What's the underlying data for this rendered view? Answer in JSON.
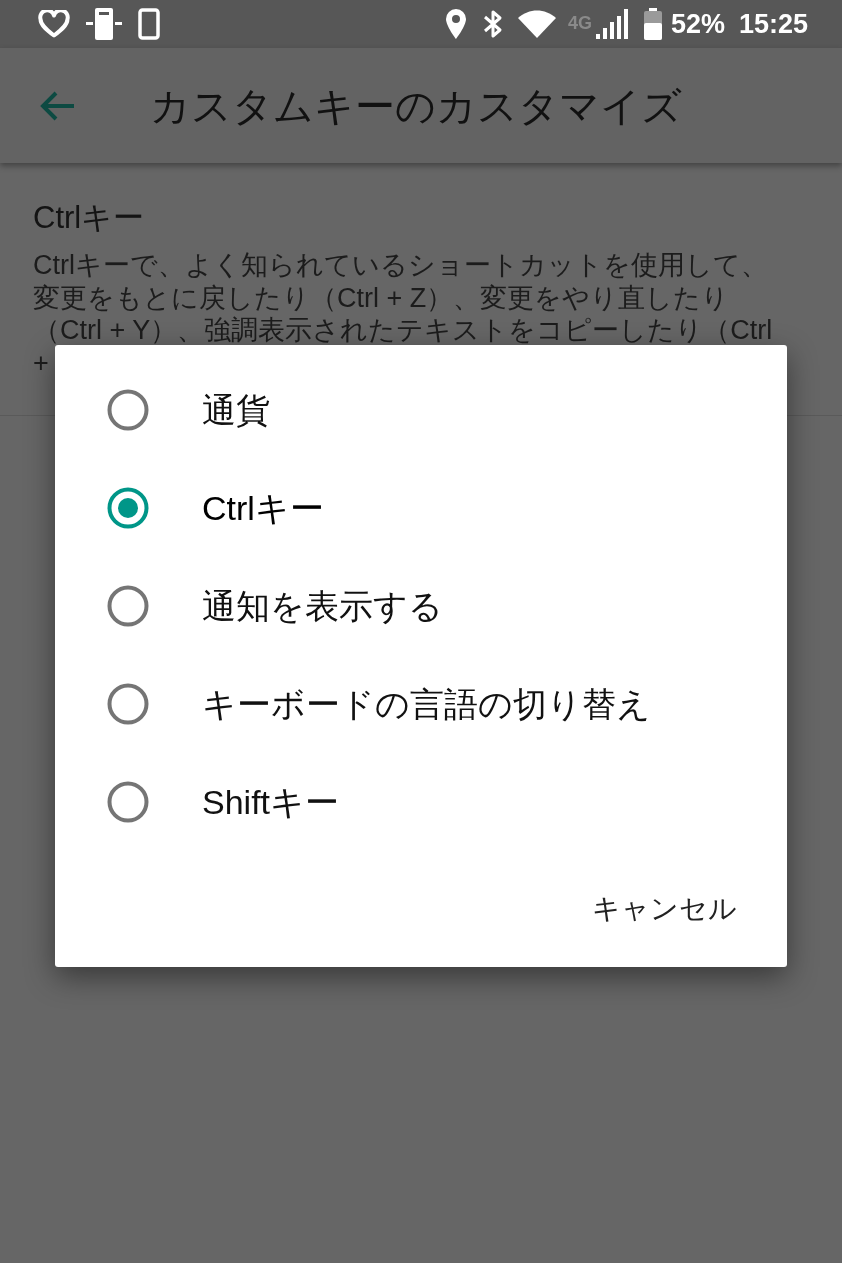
{
  "status_bar": {
    "network": "4G",
    "battery": "52%",
    "time": "15:25"
  },
  "app_bar": {
    "title": "カスタムキーのカスタマイズ"
  },
  "preference": {
    "title": "Ctrlキー",
    "description_lines": [
      "Ctrlキーで、よく知られているショートカットを使用して、",
      "変更をもとに戻したり（Ctrl + Z）、変更をやり直したり",
      "（Ctrl + Y）、強調表示されたテキストをコピーしたり（Ctrl",
      "+"
    ]
  },
  "dialog": {
    "options": [
      {
        "label": "通貨",
        "selected": false
      },
      {
        "label": "Ctrlキー",
        "selected": true
      },
      {
        "label": "通知を表示する",
        "selected": false
      },
      {
        "label": "キーボードの言語の切り替え",
        "selected": false
      },
      {
        "label": "Shiftキー",
        "selected": false
      }
    ],
    "buttons": [
      "キャンセル"
    ]
  }
}
